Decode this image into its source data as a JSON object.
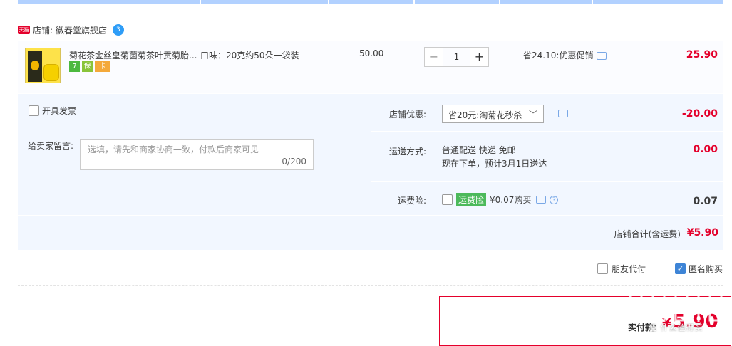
{
  "shop": {
    "tmall_badge": "天猫",
    "label": "店铺: 徽春堂旗舰店",
    "chat_badge": "3"
  },
  "item": {
    "title": "菊花茶金丝皇菊菌菊茶叶贡菊胎...",
    "spec": "口味：20克约50朵一袋装",
    "badges": [
      "7",
      "保",
      "卡"
    ],
    "unit_price": "50.00",
    "qty_minus": "−",
    "quantity": "1",
    "qty_plus": "+",
    "promo": "省24.10:优惠促销",
    "price": "25.90"
  },
  "options": {
    "invoice_label": "开具发票",
    "message_label": "给卖家留言:",
    "message_placeholder": "选填，请先和商家协商一致，付款后商家可见",
    "message_count": "0/200",
    "shop_discount_label": "店铺优惠:",
    "shop_discount_value": "省20元:淘菊花秒杀",
    "shop_discount_amount": "-20.00",
    "shipping_label": "运送方式:",
    "shipping_line1": "普通配送 快递 免邮",
    "shipping_line2": "现在下单，预计3月1日送达",
    "shipping_amount": "0.00",
    "insurance_label": "运费险:",
    "insurance_tag": "运费险",
    "insurance_price": "¥0.07购买",
    "insurance_amount": "0.07",
    "shop_total_label": "店铺合计(含运费)",
    "shop_total_value": "¥5.90"
  },
  "footer": {
    "friend_pay_label": "朋友代付",
    "anonymous_label": "匿名购买",
    "anonymous_checked": true,
    "pay_label": "实付款:",
    "pay_currency": "¥",
    "pay_value": "5.90",
    "watermark": "值 什么值得买"
  },
  "colors": {
    "accent_red": "#e4002b",
    "panel_blue": "#f2f7ff",
    "link_blue": "#3d84d6"
  }
}
